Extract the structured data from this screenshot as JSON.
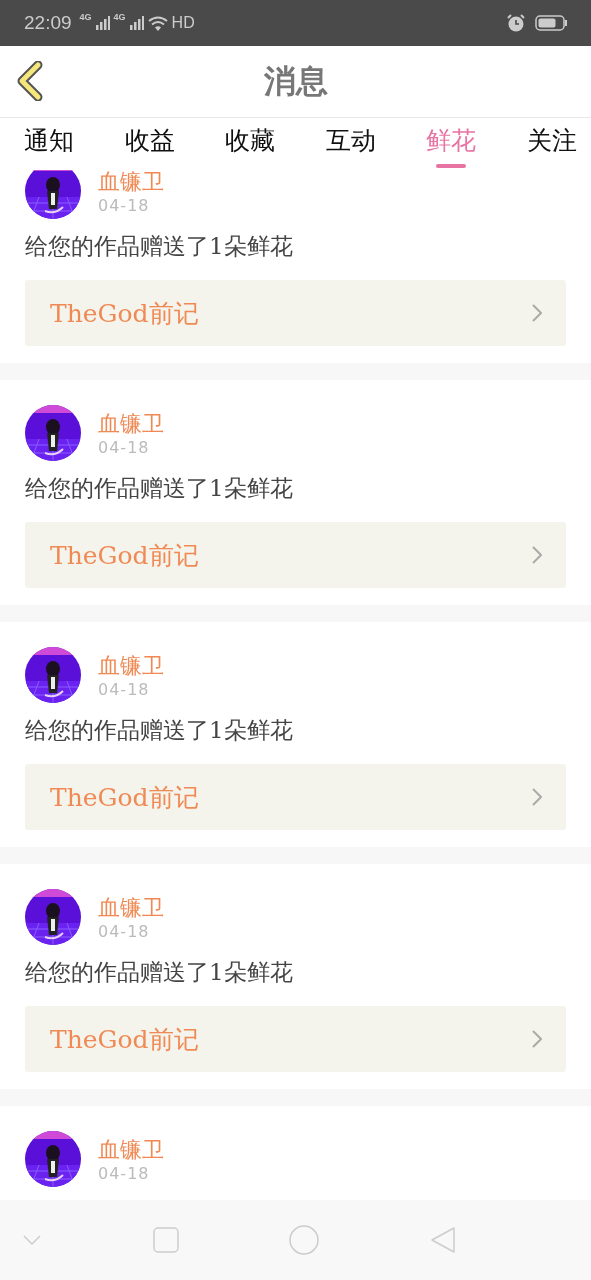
{
  "status_bar": {
    "time": "22:09",
    "network_1": "4G",
    "network_2": "4G",
    "hd": "HD"
  },
  "header": {
    "title": "消息"
  },
  "tabs": [
    {
      "label": "通知",
      "selected": false
    },
    {
      "label": "收益",
      "selected": false
    },
    {
      "label": "收藏",
      "selected": false
    },
    {
      "label": "互动",
      "selected": false
    },
    {
      "label": "鲜花",
      "selected": true
    },
    {
      "label": "关注",
      "selected": false
    }
  ],
  "messages": [
    {
      "user": "血镰卫",
      "date": "04-18",
      "text": "给您的作品赠送了1朵鲜花",
      "work": "TheGod前记"
    },
    {
      "user": "血镰卫",
      "date": "04-18",
      "text": "给您的作品赠送了1朵鲜花",
      "work": "TheGod前记"
    },
    {
      "user": "血镰卫",
      "date": "04-18",
      "text": "给您的作品赠送了1朵鲜花",
      "work": "TheGod前记"
    },
    {
      "user": "血镰卫",
      "date": "04-18",
      "text": "给您的作品赠送了1朵鲜花",
      "work": "TheGod前记"
    },
    {
      "user": "血镰卫",
      "date": "04-18"
    }
  ]
}
